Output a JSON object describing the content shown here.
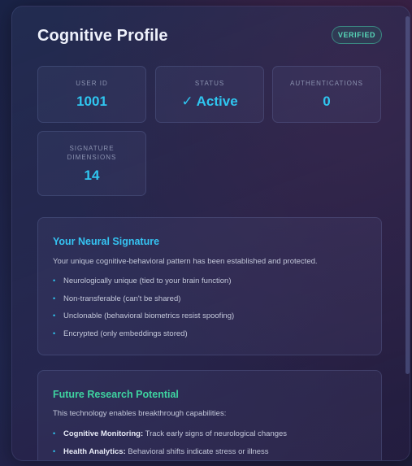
{
  "header": {
    "title": "Cognitive Profile",
    "badge": "VERIFIED"
  },
  "stats": [
    {
      "label": "USER ID",
      "value": "1001"
    },
    {
      "label": "STATUS",
      "value": "✓ Active"
    },
    {
      "label": "AUTHENTICATIONS",
      "value": "0"
    },
    {
      "label": "SIGNATURE DIMENSIONS",
      "value": "14"
    }
  ],
  "signature": {
    "title": "Your Neural Signature",
    "intro": "Your unique cognitive-behavioral pattern has been established and protected.",
    "items": [
      "Neurologically unique (tied to your brain function)",
      "Non-transferable (can't be shared)",
      "Unclonable (behavioral biometrics resist spoofing)",
      "Encrypted (only embeddings stored)"
    ]
  },
  "research": {
    "title": "Future Research Potential",
    "intro": "This technology enables breakthrough capabilities:",
    "items": [
      {
        "term": "Cognitive Monitoring:",
        "text": " Track early signs of neurological changes"
      },
      {
        "term": "Health Analytics:",
        "text": " Behavioral shifts indicate stress or illness"
      }
    ]
  },
  "colors": {
    "accent_cyan": "#2fc6f0",
    "signature_title": "#35c3f2",
    "research_title": "#3ed3a0",
    "verified_green": "#57d6b8"
  }
}
